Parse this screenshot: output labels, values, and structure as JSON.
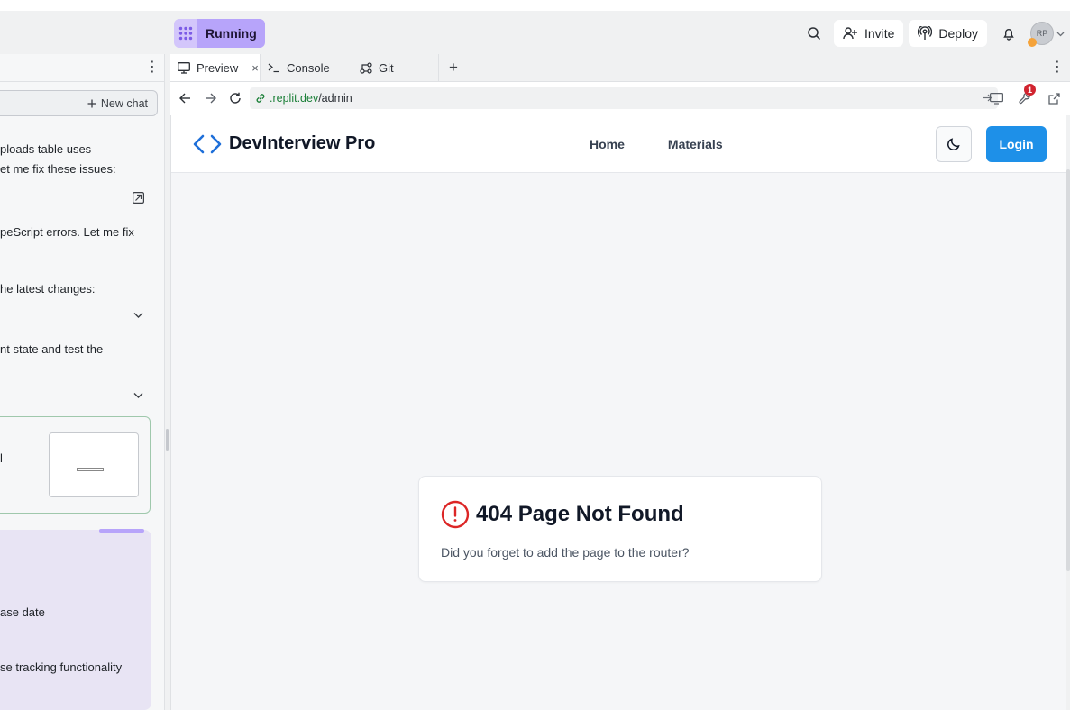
{
  "topbar": {
    "run_status": "Running",
    "invite_label": "Invite",
    "deploy_label": "Deploy",
    "avatar_initials": "RP"
  },
  "chat": {
    "new_chat_label": "New chat",
    "lines": [
      "ploads table uses",
      "et me fix these issues:",
      "peScript errors. Let me fix",
      "he latest changes:",
      "nt state and test the",
      "l",
      "ase date",
      "se tracking functionality"
    ]
  },
  "workspace": {
    "tabs": [
      {
        "label": "Preview"
      },
      {
        "label": "Console"
      },
      {
        "label": "Git"
      }
    ],
    "url_domain": ".replit.dev",
    "url_path": "/admin",
    "notification_count": "1"
  },
  "app": {
    "brand": "DevInterview Pro",
    "nav_links": [
      "Home",
      "Materials"
    ],
    "login_label": "Login",
    "error_title": "404 Page Not Found",
    "error_desc": "Did you forget to add the page to the router?"
  },
  "colors": {
    "running_accent": "#b7a4fa",
    "login_blue": "#1e90e8",
    "error_red": "#dc2626",
    "url_green": "#1a7f37"
  },
  "icons": [
    "grid-icon",
    "search-icon",
    "user-plus-icon",
    "deploy-icon",
    "bell-icon",
    "chevron-down-icon",
    "more-icon",
    "plus-icon",
    "external-link-icon",
    "preview-icon",
    "console-icon",
    "git-icon",
    "close-icon",
    "back-arrow-icon",
    "forward-arrow-icon",
    "refresh-icon",
    "link-icon",
    "go-arrow-icon",
    "devices-icon",
    "wrench-icon",
    "code-brackets-icon",
    "moon-icon",
    "alert-circle-icon"
  ]
}
